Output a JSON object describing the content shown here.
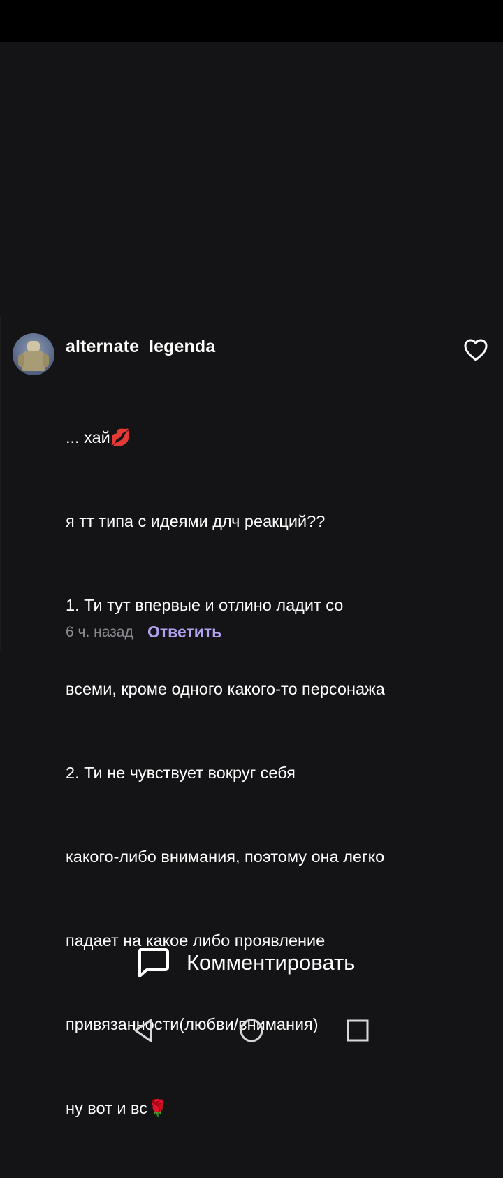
{
  "comment": {
    "username": "alternate_legenda",
    "lines": [
      "... хай💋",
      "я тт типа с идеями длч реакций??",
      "1. Ти тут впервые и отлино ладит со",
      "всеми, кроме одного какого-то персонажа",
      "2. Ти не чувствует вокруг себя",
      "какого-либо внимания, поэтому она легко",
      "падает на какое либо проявление",
      "привязанности(любви/внимания)",
      "ну вот и вс🌹"
    ],
    "time": "6 ч. назад",
    "reply_label": "Ответить",
    "like_icon": "heart-outline-icon"
  },
  "bottom": {
    "comment_label": "Комментировать",
    "comment_icon": "speech-bubble-icon"
  },
  "nav": {
    "back_icon": "back-triangle-icon",
    "home_icon": "home-circle-icon",
    "recents_icon": "recents-square-icon"
  },
  "colors": {
    "background": "#141315",
    "accent": "#b3a2f1",
    "muted": "#8e8b93"
  }
}
